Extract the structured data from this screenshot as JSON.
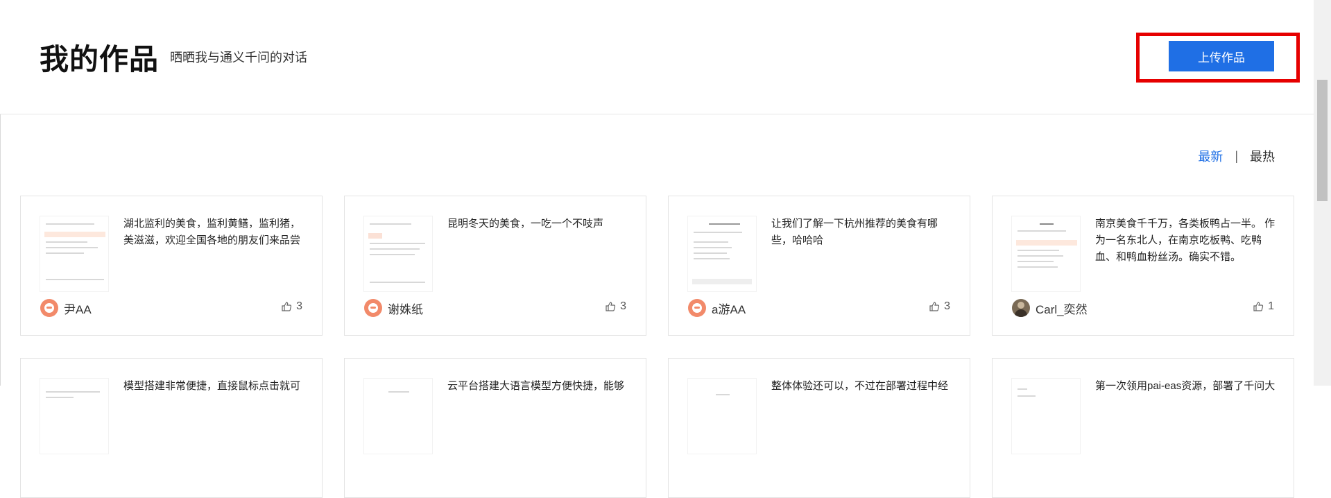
{
  "header": {
    "title": "我的作品",
    "subtitle": "晒晒我与通义千问的对话",
    "upload_label": "上传作品"
  },
  "sort": {
    "newest": "最新",
    "separator": "|",
    "hottest": "最热",
    "active": "最新"
  },
  "colors": {
    "accent": "#1f6fe5",
    "highlight_border": "#e60000"
  },
  "cards": [
    {
      "text": "湖北监利的美食，监利黄鳝，监利猪，美滋滋，欢迎全国各地的朋友们来品尝",
      "author": "尹AA",
      "likes": "3",
      "avatar": "default-avatar-icon"
    },
    {
      "text": "昆明冬天的美食，一吃一个不吱声",
      "author": "谢姝纸",
      "likes": "3",
      "avatar": "default-avatar-icon"
    },
    {
      "text": "让我们了解一下杭州推荐的美食有哪些，哈哈哈",
      "author": "a游AA",
      "likes": "3",
      "avatar": "default-avatar-icon"
    },
    {
      "text": "南京美食千千万，各类板鸭占一半。 作为一名东北人，在南京吃板鸭、吃鸭血、和鸭血粉丝汤。确实不错。",
      "author": "Carl_奕然",
      "likes": "1",
      "avatar": "photo-avatar"
    },
    {
      "text": "模型搭建非常便捷，直接鼠标点击就可",
      "author": "",
      "likes": "",
      "avatar": ""
    },
    {
      "text": "云平台搭建大语言模型方便快捷，能够",
      "author": "",
      "likes": "",
      "avatar": ""
    },
    {
      "text": "整体体验还可以，不过在部署过程中经",
      "author": "",
      "likes": "",
      "avatar": ""
    },
    {
      "text": "第一次领用pai-eas资源，部署了千问大",
      "author": "",
      "likes": "",
      "avatar": ""
    }
  ]
}
